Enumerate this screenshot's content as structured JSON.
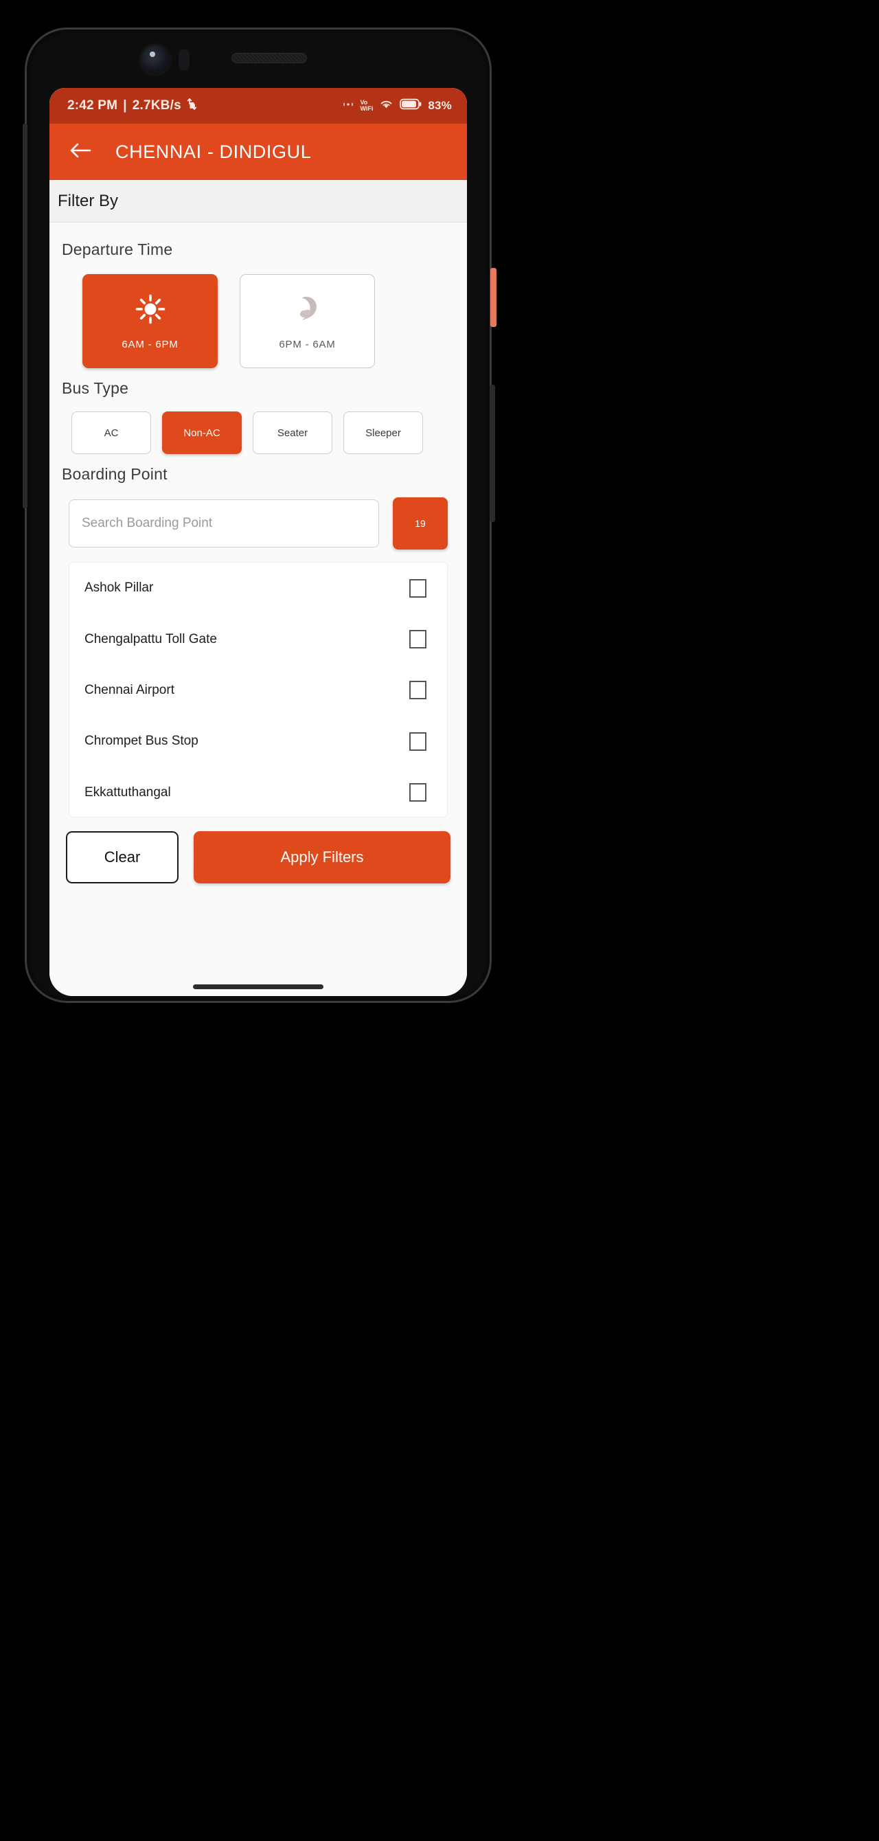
{
  "status_bar": {
    "time": "2:42 PM",
    "separator": "|",
    "network_speed": "2.7KB/s",
    "speed_icon": "upload-download-arrows-icon",
    "cast_icon": "cast-icon",
    "volte_line1": "Vo",
    "volte_line2": "WiFi",
    "wifi_icon": "wifi-icon",
    "battery_icon": "battery-icon",
    "battery_percent": "83%"
  },
  "app_bar": {
    "back_icon": "arrow-left-icon",
    "title": "CHENNAI - DINDIGUL"
  },
  "filter_bar": {
    "label": "Filter By"
  },
  "departure": {
    "title": "Departure Time",
    "options": [
      {
        "label": "6AM - 6PM",
        "icon": "sun-icon",
        "selected": true
      },
      {
        "label": "6PM - 6AM",
        "icon": "moon-icon",
        "selected": false
      }
    ]
  },
  "bus_type": {
    "title": "Bus Type",
    "options": [
      {
        "label": "AC",
        "selected": false
      },
      {
        "label": "Non-AC",
        "selected": true
      },
      {
        "label": "Seater",
        "selected": false
      },
      {
        "label": "Sleeper",
        "selected": false
      }
    ]
  },
  "boarding": {
    "title": "Boarding Point",
    "search_placeholder": "Search Boarding Point",
    "search_value": "",
    "count_badge": "19",
    "items": [
      {
        "name": "Ashok Pillar",
        "checked": false
      },
      {
        "name": "Chengalpattu Toll Gate",
        "checked": false
      },
      {
        "name": "Chennai Airport",
        "checked": false
      },
      {
        "name": "Chrompet Bus Stop",
        "checked": false
      },
      {
        "name": "Ekkattuthangal",
        "checked": false
      }
    ]
  },
  "actions": {
    "clear_label": "Clear",
    "apply_label": "Apply Filters"
  },
  "colors": {
    "brand_orange": "#df4a1c",
    "status_bar_orange": "#b43316",
    "app_bar_orange": "#e0491d",
    "page_bg": "#fafafa",
    "filter_bar_bg": "#f1f1f1"
  }
}
